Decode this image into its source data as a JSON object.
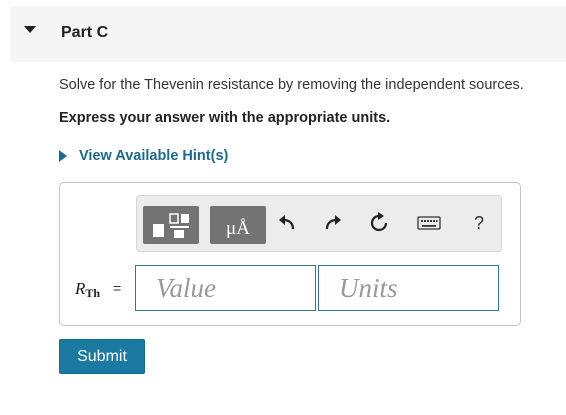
{
  "part": {
    "title": "Part C"
  },
  "question": {
    "text": "Solve for the Thevenin resistance by removing the independent sources."
  },
  "instruction": {
    "text": "Express your answer with the appropriate units."
  },
  "hints": {
    "label": "View Available Hint(s)"
  },
  "toolbar": {
    "buttons": [
      {
        "name": "templates",
        "icon": "template-icon"
      },
      {
        "name": "units",
        "icon": "units-icon",
        "label": "μÅ"
      },
      {
        "name": "undo",
        "icon": "undo-icon"
      },
      {
        "name": "redo",
        "icon": "redo-icon"
      },
      {
        "name": "reset",
        "icon": "reset-icon"
      },
      {
        "name": "keyboard",
        "icon": "keyboard-icon"
      },
      {
        "name": "help",
        "icon": "help-icon",
        "label": "?"
      }
    ]
  },
  "answer": {
    "variable": "R",
    "variable_sub": "Th",
    "equals": "=",
    "value_placeholder": "Value",
    "units_placeholder": "Units"
  },
  "submit": {
    "label": "Submit"
  },
  "colors": {
    "accent": "#1b7aa2",
    "link": "#1c6b8e",
    "toolbar_dark": "#737373"
  }
}
